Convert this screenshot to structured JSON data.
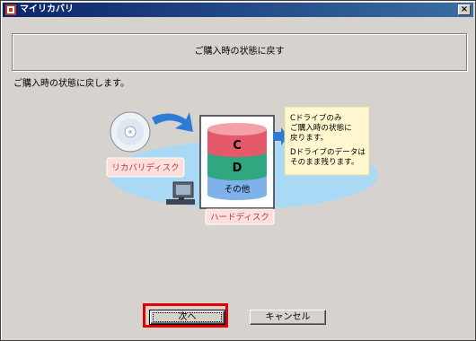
{
  "window": {
    "title": "マイリカバリ"
  },
  "header": {
    "title": "ご購入時の状態に戻す"
  },
  "description": "ご購入時の状態に戻します。",
  "illustration": {
    "recovery_disk_label": "リカバリディスク",
    "drive_c": "C",
    "drive_d": "D",
    "drive_other": "その他",
    "hard_disk_label": "ハードディスク",
    "note_lines": [
      "Cドライブのみ",
      "ご購入時の状態に",
      "戻ります。",
      "Dドライブのデータは",
      "そのまま残ります。"
    ]
  },
  "buttons": {
    "next": "次へ",
    "cancel": "キャンセル"
  },
  "colors": {
    "titlebar": "#0a246a",
    "face": "#d6d3ce",
    "highlight": "#e00000",
    "ellipse": "#a9d9f5",
    "drive_c": "#e45a6a",
    "drive_d": "#2fa882",
    "drive_other": "#7fb2ea",
    "note_bg": "#fff7cf",
    "label_bg": "#fde0de"
  }
}
